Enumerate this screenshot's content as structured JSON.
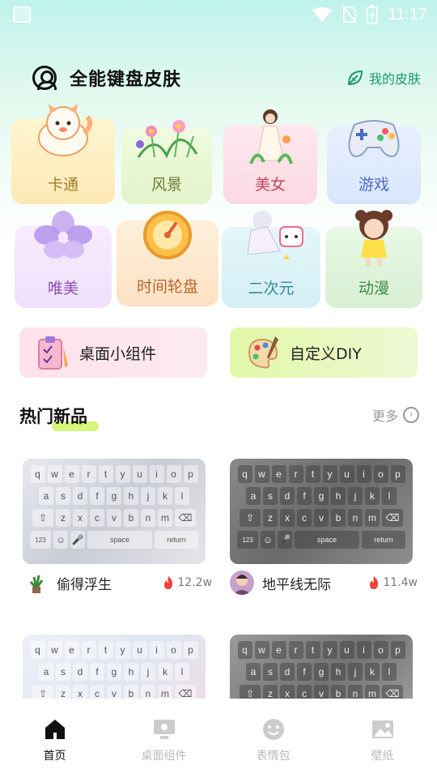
{
  "status": {
    "time": "11:17"
  },
  "header": {
    "title": "全能键盘皮肤",
    "my_skin": "我的皮肤"
  },
  "categories": [
    {
      "label": "卡通",
      "icon": "cartoon-cat-icon",
      "color": "#a67c2c"
    },
    {
      "label": "风景",
      "icon": "flowers-icon",
      "color": "#6b7b2e"
    },
    {
      "label": "美女",
      "icon": "girl-icon",
      "color": "#c04a5a"
    },
    {
      "label": "游戏",
      "icon": "gamepad-icon",
      "color": "#4a6bc0"
    },
    {
      "label": "唯美",
      "icon": "flower-icon",
      "color": "#8a4fb8"
    },
    {
      "label": "时间轮盘",
      "icon": "wheel-icon",
      "color": "#b8642a"
    },
    {
      "label": "二次元",
      "icon": "anime-icon",
      "color": "#3a8a9a"
    },
    {
      "label": "动漫",
      "icon": "doll-icon",
      "color": "#3a8a4a"
    }
  ],
  "features": [
    {
      "label": "桌面小组件",
      "icon": "clipboard-icon"
    },
    {
      "label": "自定义DIY",
      "icon": "palette-icon"
    }
  ],
  "section": {
    "title": "热门新品",
    "more": "更多"
  },
  "keyboards": [
    {
      "name": "偷得浮生",
      "hot": "12.2w",
      "theme": "light"
    },
    {
      "name": "地平线无际",
      "hot": "11.4w",
      "theme": "dark"
    },
    {
      "theme": "pink"
    },
    {
      "theme": "gray"
    }
  ],
  "keys": {
    "row1": [
      "q",
      "w",
      "e",
      "r",
      "t",
      "y",
      "u",
      "i",
      "o",
      "p"
    ],
    "row2": [
      "a",
      "s",
      "d",
      "f",
      "g",
      "h",
      "j",
      "k",
      "l"
    ],
    "row3": [
      "z",
      "x",
      "c",
      "v",
      "b",
      "n",
      "m"
    ],
    "num": "123",
    "space": "space",
    "return": "return"
  },
  "nav": [
    {
      "label": "首页",
      "icon": "home-icon",
      "active": true
    },
    {
      "label": "桌面组件",
      "icon": "monitor-icon",
      "active": false
    },
    {
      "label": "表情包",
      "icon": "smiley-icon",
      "active": false
    },
    {
      "label": "壁纸",
      "icon": "image-icon",
      "active": false
    }
  ],
  "colors": {
    "accent": "#1a9b6d",
    "hot": "#f04040",
    "highlight": "#d6f57a"
  }
}
